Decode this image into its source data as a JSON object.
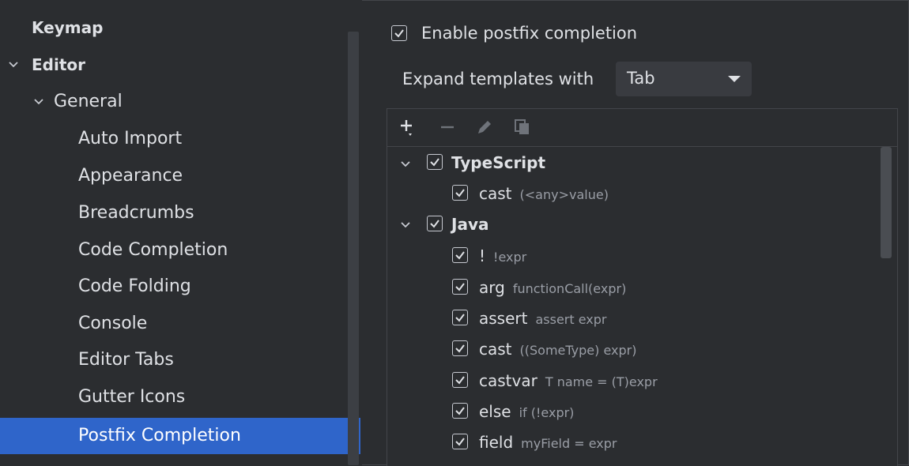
{
  "nav": {
    "keymap": "Keymap",
    "editor": "Editor",
    "general": "General",
    "items": [
      "Auto Import",
      "Appearance",
      "Breadcrumbs",
      "Code Completion",
      "Code Folding",
      "Console",
      "Editor Tabs",
      "Gutter Icons"
    ],
    "selected": "Postfix Completion"
  },
  "settings": {
    "enable_label": "Enable postfix completion",
    "expand_label": "Expand templates with",
    "expand_value": "Tab"
  },
  "toolbar": {
    "icons": [
      "add-icon",
      "remove-icon",
      "edit-icon",
      "copy-icon"
    ]
  },
  "tree": {
    "groups": [
      {
        "name": "TypeScript",
        "items": [
          {
            "key": "cast",
            "desc": "(<any>value)"
          }
        ]
      },
      {
        "name": "Java",
        "items": [
          {
            "key": "!",
            "desc": "!expr"
          },
          {
            "key": "arg",
            "desc": "functionCall(expr)"
          },
          {
            "key": "assert",
            "desc": "assert expr"
          },
          {
            "key": "cast",
            "desc": "((SomeType) expr)"
          },
          {
            "key": "castvar",
            "desc": "T name = (T)expr"
          },
          {
            "key": "else",
            "desc": "if (!expr)"
          },
          {
            "key": "field",
            "desc": "myField = expr"
          }
        ]
      }
    ]
  },
  "colors": {
    "background": "#2b2d30",
    "selection": "#2f65ca",
    "text": "#dfe1e5",
    "muted": "#9a9ea6"
  }
}
